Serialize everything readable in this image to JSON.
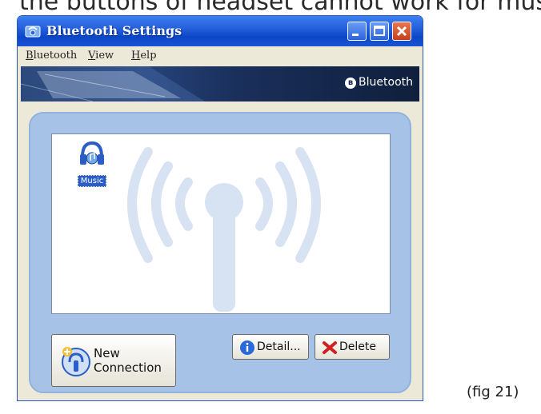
{
  "document": {
    "top_text": "the buttons of headset cannot work for music pl",
    "figure_caption": "(fig 21)"
  },
  "window": {
    "title": "Bluetooth Settings",
    "icon": "bluetooth-settings-icon",
    "controls": {
      "minimize_icon": "minimize-icon",
      "maximize_icon": "maximize-icon",
      "close_icon": "close-icon"
    }
  },
  "menubar": {
    "items": [
      {
        "accel": "B",
        "rest": "luetooth"
      },
      {
        "accel": "V",
        "rest": "iew"
      },
      {
        "accel": "H",
        "rest": "elp"
      }
    ]
  },
  "banner": {
    "brand": "Bluetooth",
    "brand_icon": "bluetooth-logo-icon"
  },
  "devices": {
    "items": [
      {
        "label": "Music",
        "icon": "headphones-music-icon",
        "selected": true
      }
    ],
    "background_icon": "bluetooth-antenna-watermark"
  },
  "buttons": {
    "new_connection": {
      "label": "New\nConnection",
      "icon": "new-connection-icon"
    },
    "detail": {
      "label": "Detail...",
      "icon": "info-icon"
    },
    "delete": {
      "label": "Delete",
      "icon": "delete-x-icon"
    }
  },
  "colors": {
    "titlebar": "#0a47c8",
    "panel": "#a6c2e6",
    "selection": "#2a5dc8",
    "delete_x": "#d02020",
    "info": "#2a6ad8"
  }
}
